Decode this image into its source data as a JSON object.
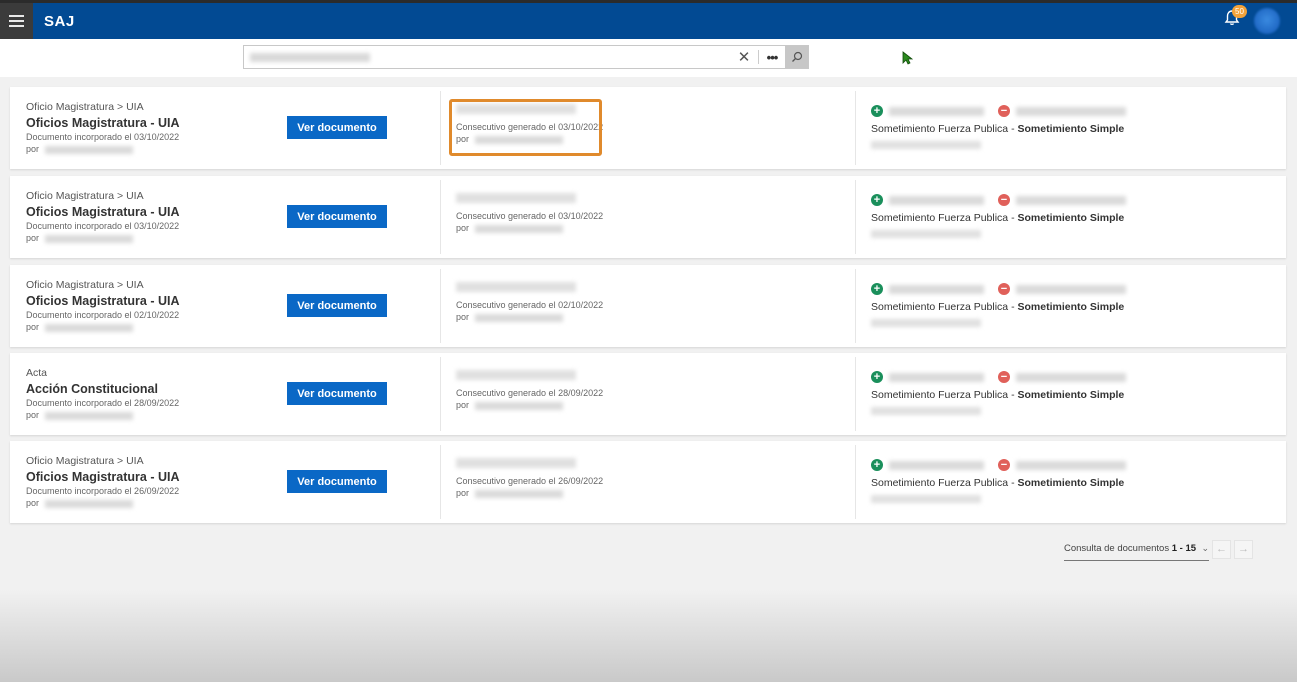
{
  "app": {
    "title": "SAJ",
    "notification_count": "50"
  },
  "search": {
    "value": "",
    "placeholder": "",
    "clear": "✕",
    "more": "•••"
  },
  "colors": {
    "header": "#024a93",
    "primary_button": "#0a68c6",
    "highlight": "#e08a2c",
    "add": "#1a8f5b",
    "remove": "#e0605a"
  },
  "cards": [
    {
      "breadcrumb": "Oficio Magistratura > UIA",
      "title": "Oficios Magistratura - UIA",
      "incorporated": "Documento incorporado el 03/10/2022",
      "por": "por",
      "button": "Ver documento",
      "consecutive": "Consecutivo generado el 03/10/2022",
      "por2": "por",
      "type_prefix": "Sometimiento Fuerza Publica - ",
      "type_bold": "Sometimiento Simple"
    },
    {
      "breadcrumb": "Oficio Magistratura > UIA",
      "title": "Oficios Magistratura - UIA",
      "incorporated": "Documento incorporado el 03/10/2022",
      "por": "por",
      "button": "Ver documento",
      "consecutive": "Consecutivo generado el 03/10/2022",
      "por2": "por",
      "type_prefix": "Sometimiento Fuerza Publica - ",
      "type_bold": "Sometimiento Simple"
    },
    {
      "breadcrumb": "Oficio Magistratura > UIA",
      "title": "Oficios Magistratura - UIA",
      "incorporated": "Documento incorporado el 02/10/2022",
      "por": "por",
      "button": "Ver documento",
      "consecutive": "Consecutivo generado el 02/10/2022",
      "por2": "por",
      "type_prefix": "Sometimiento Fuerza Publica - ",
      "type_bold": "Sometimiento Simple"
    },
    {
      "breadcrumb": "Acta",
      "title": "Acción Constitucional",
      "incorporated": "Documento incorporado el 28/09/2022",
      "por": "por",
      "button": "Ver documento",
      "consecutive": "Consecutivo generado el 28/09/2022",
      "por2": "por",
      "type_prefix": "Sometimiento Fuerza Publica - ",
      "type_bold": "Sometimiento Simple"
    },
    {
      "breadcrumb": "Oficio Magistratura > UIA",
      "title": "Oficios Magistratura - UIA",
      "incorporated": "Documento incorporado el 26/09/2022",
      "por": "por",
      "button": "Ver documento",
      "consecutive": "Consecutivo generado el 26/09/2022",
      "por2": "por",
      "type_prefix": "Sometimiento Fuerza Publica - ",
      "type_bold": "Sometimiento Simple"
    }
  ],
  "pager": {
    "label": "Consulta de documentos ",
    "range": "1 - 15",
    "prev": "←",
    "next": "→"
  }
}
